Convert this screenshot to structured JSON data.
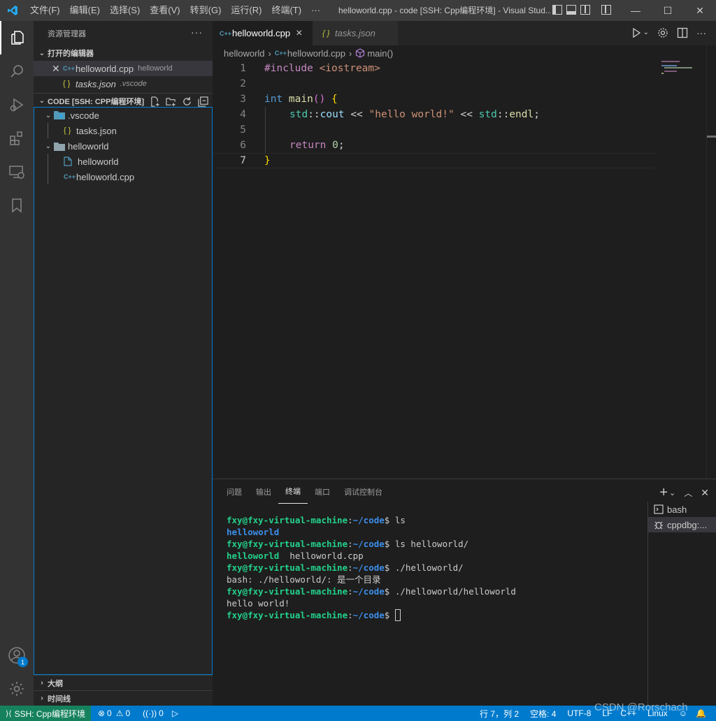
{
  "titlebar": {
    "menu": [
      "文件(F)",
      "编辑(E)",
      "选择(S)",
      "查看(V)",
      "转到(G)",
      "运行(R)",
      "终端(T)",
      "···"
    ],
    "title": "helloworld.cpp - code [SSH: Cpp编程环境] - Visual Stud..."
  },
  "activity": {
    "accounts_badge": "1"
  },
  "sidebar": {
    "header": "资源管理器",
    "more": "···",
    "open_editors": {
      "label": "打开的编辑器",
      "items": [
        {
          "name": "helloworld.cpp",
          "desc": "helloworld"
        },
        {
          "name": "tasks.json",
          "desc": ".vscode"
        }
      ]
    },
    "folder": {
      "label": "CODE [SSH: CPP编程环境]",
      "tree": [
        {
          "name": ".vscode"
        },
        {
          "name": "tasks.json"
        },
        {
          "name": "helloworld"
        },
        {
          "name": "helloworld"
        },
        {
          "name": "helloworld.cpp"
        }
      ]
    },
    "outline": "大纲",
    "timeline": "时间线"
  },
  "tabs": [
    {
      "label": "helloworld.cpp",
      "close": "×"
    },
    {
      "label": "tasks.json"
    }
  ],
  "breadcrumb": [
    "helloworld",
    "helloworld.cpp",
    "main()"
  ],
  "code": {
    "line_numbers": [
      "1",
      "2",
      "3",
      "4",
      "5",
      "6",
      "7"
    ],
    "l1": {
      "a": "#include ",
      "b": "<iostream>"
    },
    "l3": {
      "a": "int ",
      "b": "main",
      "c": "()",
      "d": " {"
    },
    "l4": {
      "a": "std",
      "b": "::",
      "c": "cout",
      "d": " << ",
      "e": "\"hello world!\"",
      "f": " << ",
      "g": "std",
      "h": "::",
      "i": "endl",
      "j": ";"
    },
    "l6": {
      "a": "return ",
      "b": "0",
      "c": ";"
    },
    "l7": {
      "a": "}"
    }
  },
  "panel": {
    "tabs": [
      "问题",
      "输出",
      "终端",
      "端口",
      "调试控制台"
    ],
    "terminal": {
      "prompt_user": "fxy@fxy-virtual-machine",
      "prompt_colon": ":",
      "prompt_path": "~/code",
      "prompt_dollar": "$",
      "cmd1": " ls",
      "out1": "helloworld",
      "cmd2": " ls helloworld/",
      "out2a": "helloworld",
      "out2b": "  helloworld.cpp",
      "cmd3": " ./helloworld/",
      "out3": "bash: ./helloworld/: 是一个目录",
      "cmd4": " ./helloworld/helloworld",
      "out4": "hello world!"
    },
    "terminals": [
      {
        "label": "bash"
      },
      {
        "label": "cppdbg:..."
      }
    ]
  },
  "statusbar": {
    "remote": "SSH: Cpp编程环境",
    "errors": "0",
    "warnings": "0",
    "ports": "0",
    "position": "行 7，列 2",
    "spaces": "空格: 4",
    "encoding": "UTF-8",
    "eol": "LF",
    "language": "C++",
    "os": "Linux"
  },
  "watermark": "CSDN @Rorschach"
}
